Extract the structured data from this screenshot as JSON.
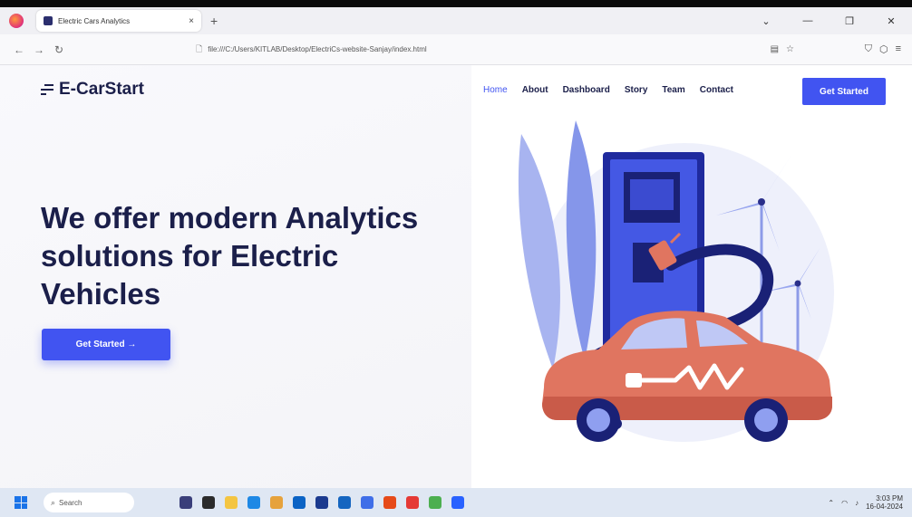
{
  "browser": {
    "tab_title": "Electric Cars Analytics",
    "tab_close": "×",
    "new_tab": "+",
    "url": "file:///C:/Users/KITLAB/Desktop/ElectriCs-website-Sanjay/index.html",
    "window_controls": [
      "⌄",
      "—",
      "❐",
      "✕"
    ]
  },
  "site": {
    "brand": "E-CarStart",
    "nav": [
      {
        "label": "Home",
        "active": true
      },
      {
        "label": "About",
        "active": false
      },
      {
        "label": "Dashboard",
        "active": false
      },
      {
        "label": "Story",
        "active": false
      },
      {
        "label": "Team",
        "active": false
      },
      {
        "label": "Contact",
        "active": false
      }
    ],
    "nav_cta": "Get Started",
    "hero_title": "We offer modern Analytics solutions for Electric Vehicles",
    "hero_cta": "Get Started →"
  },
  "taskbar": {
    "search_placeholder": "Search",
    "time": "3:03 PM",
    "date": "16-04-2024"
  },
  "colors": {
    "accent": "#4154f1",
    "brand_dark": "#1b1f4a",
    "car": "#e07560"
  }
}
